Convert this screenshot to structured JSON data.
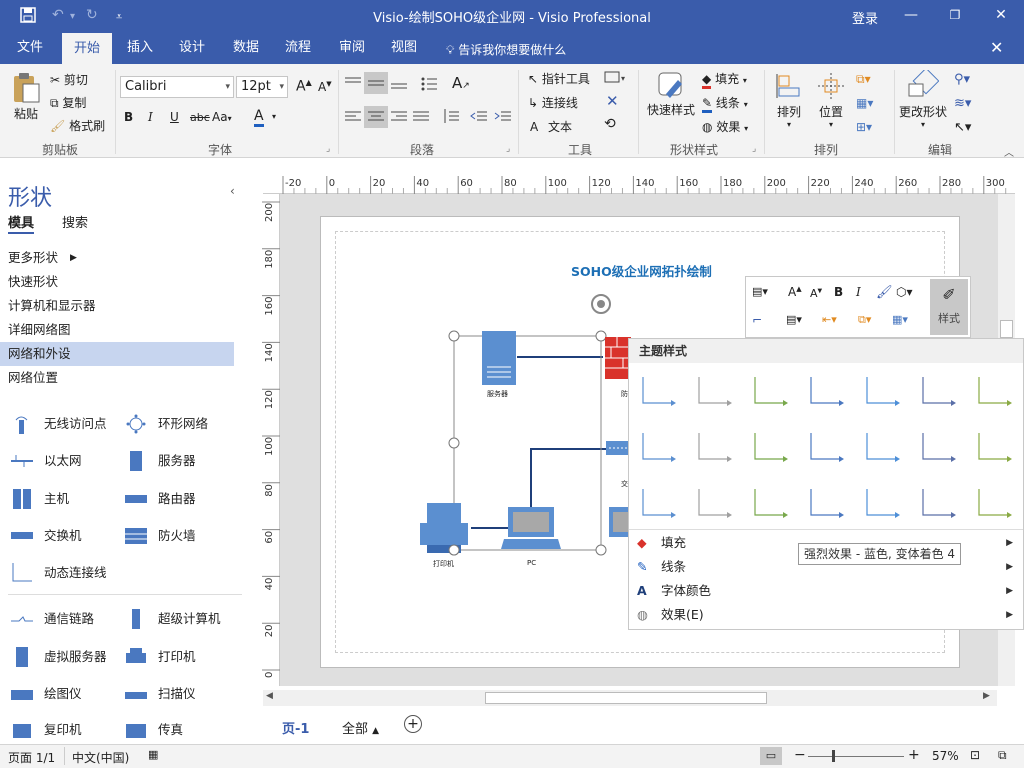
{
  "window": {
    "title": "Visio-绘制SOHO级企业网 - Visio Professional",
    "login": "登录"
  },
  "menu": {
    "tabs": [
      "文件",
      "开始",
      "插入",
      "设计",
      "数据",
      "流程",
      "审阅",
      "视图"
    ],
    "active_tab": "开始",
    "tell_me": "告诉我你想要做什么"
  },
  "ribbon": {
    "clipboard": {
      "label": "剪贴板",
      "paste": "粘贴",
      "cut": "剪切",
      "copy": "复制",
      "format_painter": "格式刷"
    },
    "font": {
      "label": "字体",
      "font_name": "Calibri",
      "font_size": "12pt",
      "bold": "B",
      "italic": "I",
      "underline": "U",
      "strike": "abc",
      "case": "Aa",
      "color": "A"
    },
    "paragraph": {
      "label": "段落"
    },
    "tools": {
      "label": "工具",
      "pointer": "指针工具",
      "connector": "连接线",
      "text": "文本"
    },
    "shape_styles": {
      "label": "形状样式",
      "quick_styles": "快速样式",
      "fill": "填充",
      "line": "线条",
      "effects": "效果"
    },
    "arrange": {
      "label": "排列",
      "arrange": "排列",
      "position": "位置"
    },
    "editing": {
      "label": "编辑",
      "change_shape": "更改形状"
    }
  },
  "shapes_panel": {
    "title": "形状",
    "tabs": [
      "模具",
      "搜索"
    ],
    "nav": [
      "更多形状",
      "快速形状",
      "计算机和显示器",
      "详细网络图",
      "网络和外设",
      "网络位置"
    ],
    "selected_nav": "网络和外设",
    "stencils_left": [
      "无线访问点",
      "以太网",
      "主机",
      "交换机",
      "动态连接线",
      "通信链路",
      "虚拟服务器",
      "绘图仪",
      "复印机"
    ],
    "stencils_right": [
      "环形网络",
      "服务器",
      "路由器",
      "防火墙",
      "超级计算机",
      "打印机",
      "扫描仪",
      "传真"
    ]
  },
  "ruler": {
    "h_ticks": [
      "-20",
      "0",
      "20",
      "40",
      "60",
      "80",
      "100",
      "120",
      "140",
      "160",
      "180",
      "200",
      "220",
      "240",
      "260",
      "280",
      "300"
    ],
    "v_ticks": [
      "200",
      "180",
      "160",
      "140",
      "120",
      "100",
      "80",
      "60",
      "40",
      "20",
      "0"
    ]
  },
  "diagram": {
    "title": "SOHO级企业网拓扑绘制",
    "labels": {
      "server": "服务器",
      "firewall": "防",
      "switch": "交",
      "printer": "打印机",
      "pc": "PC"
    }
  },
  "mini_toolbar": {
    "style_label": "样式"
  },
  "gallery": {
    "header": "主题样式",
    "menu": [
      {
        "label": "填充",
        "icon": "fill-icon"
      },
      {
        "label": "线条",
        "icon": "line-icon"
      },
      {
        "label": "字体颜色",
        "icon": "font-color-icon"
      },
      {
        "label": "效果(E)",
        "icon": "effects-icon"
      }
    ],
    "swatch_colors": [
      "#5b8fd0",
      "#a0a0a0",
      "#78a84b",
      "#4a78c0",
      "#4d8fd8",
      "#5a6fa8",
      "#8aaa44"
    ],
    "tooltip": "强烈效果 - 蓝色, 变体着色 4"
  },
  "pages": {
    "page1": "页-1",
    "all": "全部"
  },
  "status": {
    "page": "页面 1/1",
    "language": "中文(中国)",
    "zoom": "57%"
  },
  "colors": {
    "accent": "#3a5cab",
    "shape_blue": "#5b8fd0",
    "firewall_red": "#d9322b"
  }
}
